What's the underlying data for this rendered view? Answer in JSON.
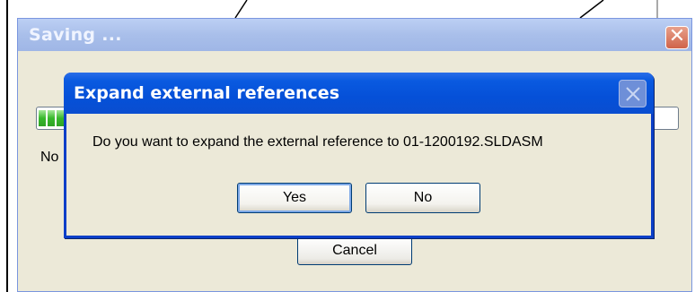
{
  "saving_dialog": {
    "title": "Saving ...",
    "close_glyph": "✕",
    "status_text": "No",
    "progress_percent": 2,
    "cancel_label": "Cancel"
  },
  "expand_dialog": {
    "title": "Expand external references",
    "message": "Do you want to expand the external reference to 01-1200192.SLDASM",
    "yes_label": "Yes",
    "no_label": "No"
  },
  "icons": {
    "saving_close": "close-icon",
    "expand_close": "close-icon"
  },
  "colors": {
    "expand_titlebar": "#0a55da",
    "saving_titlebar": "#a9bfea",
    "dialog_bg": "#ece9d8",
    "progress_green": "#37b82c",
    "close_red": "#d0634a"
  }
}
